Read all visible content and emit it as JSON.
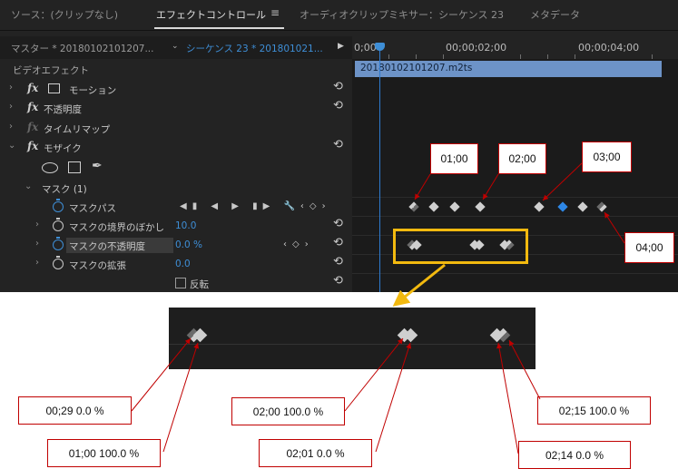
{
  "tabs": [
    {
      "label": "ソース：(クリップなし)",
      "active": false
    },
    {
      "label": "エフェクトコントロール",
      "active": true
    },
    {
      "label": "オーディオクリップミキサー：シーケンス 23",
      "active": false
    },
    {
      "label": "メタデータ",
      "active": false
    }
  ],
  "tab_menu_icon": "hamburger-icon",
  "source_bar": {
    "master": "マスター * 20180102101207...",
    "sequence": "シーケンス 23 * 201801021..."
  },
  "ruler": {
    "t0": "0;00",
    "t1": "00;00;02;00",
    "t2": "00;00;04;00"
  },
  "clip": {
    "name": "20180102101207.m2ts"
  },
  "effects": {
    "section_title": "ビデオエフェクト",
    "motion": "モーション",
    "opacity": "不透明度",
    "time_remap": "タイムリマップ",
    "mosaic": "モザイク",
    "mask_group": "マスク (1)",
    "mask_path": "マスクパス",
    "mask_feather": {
      "label": "マスクの境界のぼかし",
      "value": "10.0"
    },
    "mask_opacity": {
      "label": "マスクの不透明度",
      "value": "0.0",
      "unit": "%"
    },
    "mask_expansion": {
      "label": "マスクの拡張",
      "value": "0.0"
    },
    "invert": "反転"
  },
  "annotations": {
    "kf_0100": "01;00",
    "kf_0200": "02;00",
    "kf_0300": "03;00",
    "kf_0400": "04;00",
    "z1": "00;29  0.0 %",
    "z2": "01;00  100.0 %",
    "z3": "02;00  100.0 %",
    "z4": "02;01  0.0 %",
    "z5": "02;15  100.0 %",
    "z6": "02;14  0.0 %"
  },
  "colors": {
    "accent": "#3e8ed6",
    "highlight_box": "#f2b90f",
    "annotation_line": "#c00000",
    "clip": "#6d93c7"
  }
}
